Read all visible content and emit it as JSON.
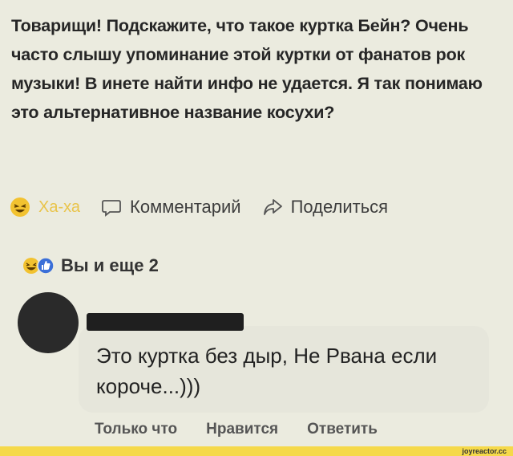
{
  "post": {
    "text": "Товарищи! Подскажите, что такое куртка Бейн? Очень часто слышу упоминание этой куртки от фанатов рок музыки! В инете найти инфо не удается. Я так понимаю это альтернативное название косухи?"
  },
  "actions": {
    "haha_label": "Ха-ха",
    "comment_label": "Комментарий",
    "share_label": "Поделиться"
  },
  "reactions": {
    "text": "Вы и еще 2"
  },
  "comment": {
    "text": "Это куртка без дыр, Не Рвана если короче...)))",
    "time": "Только что",
    "like_label": "Нравится",
    "reply_label": "Ответить"
  },
  "watermark": {
    "text": "joyreactor.cc"
  },
  "colors": {
    "haha_yellow": "#f2c230",
    "like_blue": "#3b6fd8",
    "background": "#ebebdf"
  }
}
